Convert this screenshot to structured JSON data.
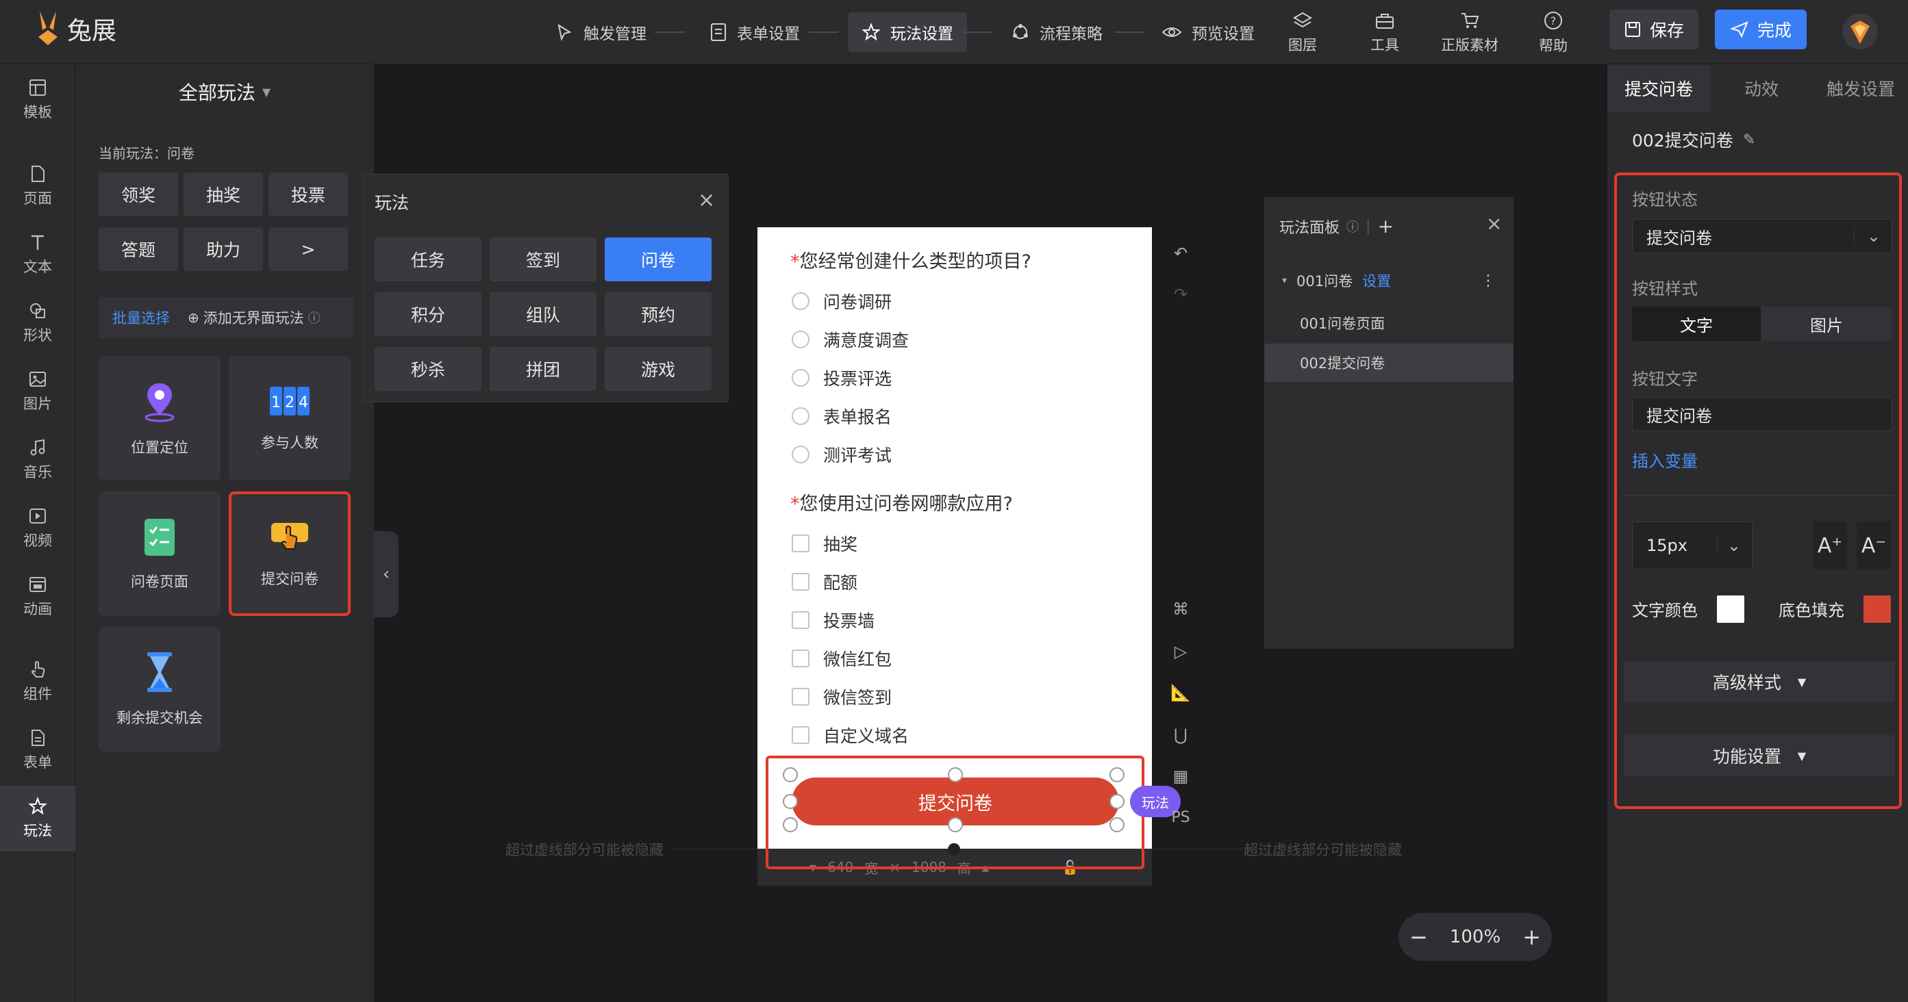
{
  "app": {
    "logo_text": "兔展"
  },
  "steps": [
    {
      "label": "触发管理",
      "icon": "cursor-click-icon"
    },
    {
      "label": "表单设置",
      "icon": "form-icon"
    },
    {
      "label": "玩法设置",
      "icon": "star-gear-icon"
    },
    {
      "label": "流程策略",
      "icon": "flow-icon"
    },
    {
      "label": "预览设置",
      "icon": "eye-icon"
    }
  ],
  "tools": [
    "图层",
    "工具",
    "正版素材",
    "帮助"
  ],
  "actions": {
    "save": "保存",
    "done": "完成"
  },
  "rail": [
    "模板",
    "页面",
    "文本",
    "形状",
    "图片",
    "音乐",
    "视频",
    "动画",
    "组件",
    "表单",
    "玩法"
  ],
  "left_panel": {
    "title": "全部玩法",
    "current_label": "当前玩法：问卷",
    "play_buttons": [
      "领奖",
      "抽奖",
      "投票",
      "答题",
      "助力",
      ">"
    ],
    "batch_select": "批量选择",
    "add_label": "添加无界面玩法",
    "cards": [
      "位置定位",
      "参与人数",
      "问卷页面",
      "提交问卷",
      "剩余提交机会"
    ]
  },
  "popup": {
    "title": "玩法",
    "buttons": [
      "任务",
      "签到",
      "问卷",
      "积分",
      "组队",
      "预约",
      "秒杀",
      "拼团",
      "游戏"
    ]
  },
  "canvas": {
    "q1": {
      "star": "*",
      "title": "您经常创建什么类型的项目?",
      "options": [
        "问卷调研",
        "满意度调查",
        "投票评选",
        "表单报名",
        "测评考试"
      ]
    },
    "q2": {
      "star": "*",
      "title": "您使用过问卷网哪款应用?",
      "options": [
        "抽奖",
        "配额",
        "投票墙",
        "微信红包",
        "微信签到",
        "自定义域名"
      ]
    },
    "submit": "提交问卷",
    "badge": "玩法",
    "bottom": {
      "width": "640",
      "w_unit": "宽",
      "height": "1008",
      "h_unit": "高"
    },
    "hint": "超过虚线部分可能被隐藏",
    "side_ps": "PS"
  },
  "play_panel": {
    "title": "玩法面板",
    "group": "001问卷",
    "group_link": "设置",
    "items": [
      "001问卷页面",
      "002提交问卷"
    ]
  },
  "zoom": {
    "value": "100%"
  },
  "right_panel": {
    "tabs": [
      "提交问卷",
      "动效",
      "触发设置"
    ],
    "name": "002提交问卷",
    "state_label": "按钮状态",
    "state_value": "提交问卷",
    "style_label": "按钮样式",
    "style_options": [
      "文字",
      "图片"
    ],
    "text_label": "按钮文字",
    "text_value": "提交问卷",
    "insert_var": "插入变量",
    "font_size": "15px",
    "text_color_label": "文字颜色",
    "fill_label": "底色填充",
    "text_color": "#ffffff",
    "fill_color": "#d6452f",
    "advanced": "高级样式",
    "function": "功能设置"
  }
}
